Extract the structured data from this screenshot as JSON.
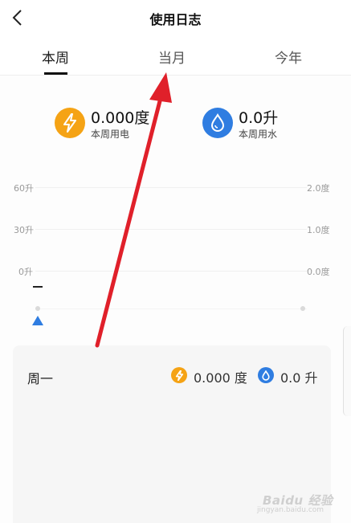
{
  "header": {
    "title": "使用日志"
  },
  "tabs": [
    {
      "label": "本周",
      "active": true
    },
    {
      "label": "当月",
      "active": false
    },
    {
      "label": "今年",
      "active": false
    }
  ],
  "summary": {
    "electricity": {
      "value": "0.000度",
      "label": "本周用电",
      "color": "#f5a315",
      "icon": "lightning-icon"
    },
    "water": {
      "value": "0.0升",
      "label": "本周用水",
      "color": "#2f7de1",
      "icon": "water-drop-icon"
    }
  },
  "chart": {
    "left_axis": [
      "60升",
      "30升",
      "0升"
    ],
    "right_axis": [
      "2.0度",
      "1.0度",
      "0.0度"
    ],
    "dash_label": "–"
  },
  "day_card": {
    "day": "周一",
    "electricity": "0.000 度",
    "water": "0.0 升"
  },
  "watermark": {
    "text": "Baidu 经验",
    "url": "jingyan.baidu.com"
  }
}
